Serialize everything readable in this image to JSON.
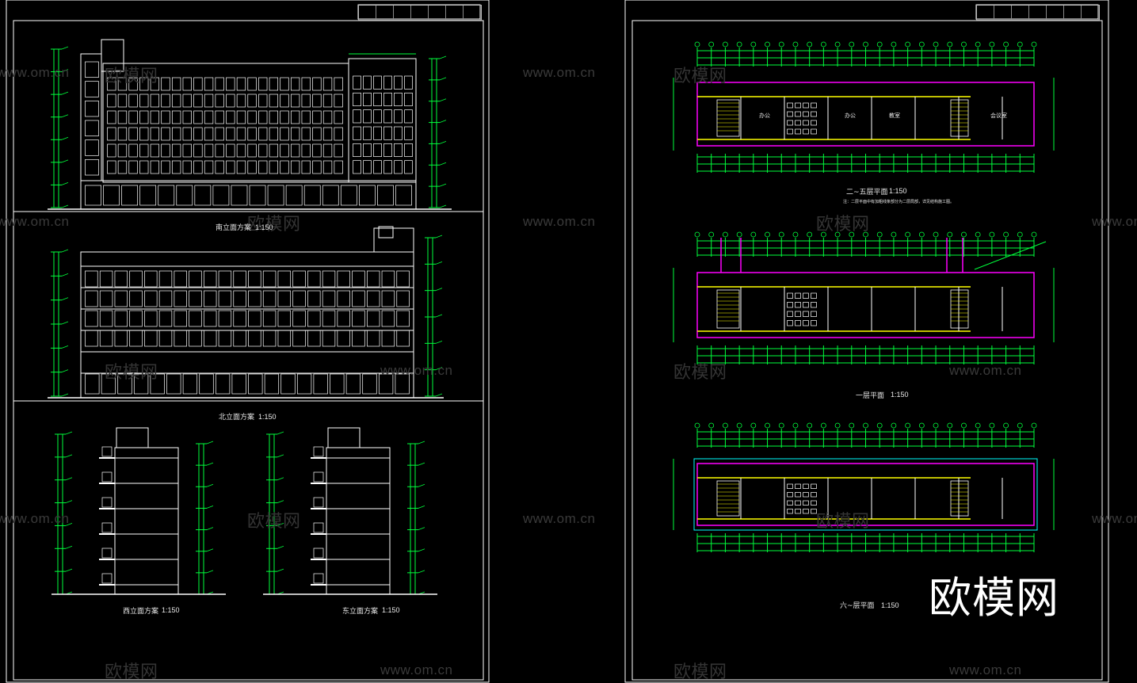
{
  "watermark": {
    "url": "www.om.cn",
    "brand": "欧模网"
  },
  "logo": "欧模网",
  "sheet_left": {
    "views": [
      {
        "title": "南立面方案",
        "scale": "1:150"
      },
      {
        "title": "北立面方案",
        "scale": "1:150"
      },
      {
        "title": "西立面方案",
        "scale": "1:150"
      },
      {
        "title": "东立面方案",
        "scale": "1:150"
      }
    ]
  },
  "sheet_right": {
    "plans": [
      {
        "title": "二~五层平面",
        "scale": "1:150",
        "note": "注：二层平面中有加粗线条部分为二层局部，详见结构施工图。"
      },
      {
        "title": "一层平面",
        "scale": "1:150"
      },
      {
        "title": "六~层平面",
        "scale": "1:150"
      }
    ],
    "room_labels": [
      "办公",
      "办公",
      "教室",
      "会议室"
    ]
  },
  "colors": {
    "background": "#000000",
    "frame": "#ffffff",
    "dimension_green": "#00ff3c",
    "wall_magenta": "#ff00ff",
    "beam_yellow": "#ffff00",
    "cyan": "#00ffff",
    "watermark": "#3a3a3a"
  }
}
